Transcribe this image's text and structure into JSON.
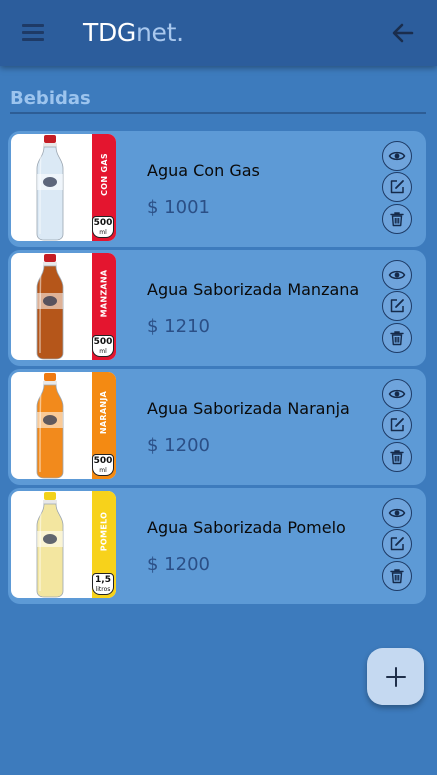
{
  "appbar": {
    "brand_main": "TDG",
    "brand_suffix": "net."
  },
  "section": {
    "title": "Bebidas"
  },
  "products": [
    {
      "name": "Agua Con Gas",
      "price": "$ 1001",
      "band_text": "CON GAS",
      "band_color": "#e4152f",
      "size_num": "500",
      "size_unit": "ml",
      "liquid_color": "#dbe9f5",
      "cap_color": "#c51d24"
    },
    {
      "name": "Agua Saborizada Manzana",
      "price": "$ 1210",
      "band_text": "MANZANA",
      "band_color": "#e4152f",
      "size_num": "500",
      "size_unit": "ml",
      "liquid_color": "#b5561a",
      "cap_color": "#c51d24"
    },
    {
      "name": "Agua Saborizada Naranja",
      "price": "$ 1200",
      "band_text": "NARANJA",
      "band_color": "#f48a12",
      "size_num": "500",
      "size_unit": "ml",
      "liquid_color": "#f28a1c",
      "cap_color": "#f07a10"
    },
    {
      "name": "Agua Saborizada Pomelo",
      "price": "$ 1200",
      "band_text": "POMELO",
      "band_color": "#f7d21b",
      "size_num": "1,5",
      "size_unit": "litros",
      "liquid_color": "#f3e6a0",
      "cap_color": "#f2d21a"
    }
  ],
  "colors": {
    "background": "#3d7bbd",
    "appbar": "#2c5d9c",
    "card": "#5d9ad6",
    "accent_dark": "#1e3b66"
  },
  "icons": {
    "menu": "hamburger-icon",
    "back": "arrow-left-icon",
    "view": "eye-icon",
    "edit": "edit-icon",
    "delete": "trash-icon",
    "add": "plus-icon"
  }
}
